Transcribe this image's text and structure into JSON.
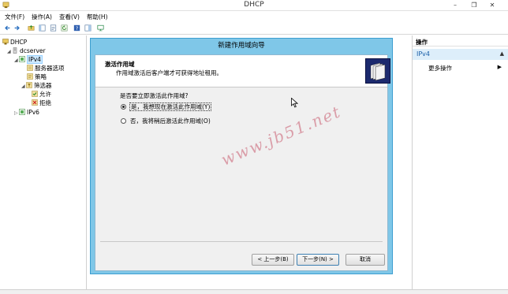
{
  "window": {
    "title": "DHCP",
    "controls": {
      "minimize": "–",
      "restore": "❐",
      "close": "✕"
    }
  },
  "menu": [
    {
      "label": "文件(F)"
    },
    {
      "label": "操作(A)"
    },
    {
      "label": "查看(V)"
    },
    {
      "label": "帮助(H)"
    }
  ],
  "toolbar": {
    "icons": [
      "back-arrow-icon",
      "forward-arrow-icon",
      "up-folder-icon",
      "show-tree-icon",
      "properties-icon",
      "refresh-icon",
      "help-icon",
      "panel-icon",
      "monitor-icon"
    ]
  },
  "tree": {
    "root": "DHCP",
    "server": "dcserver",
    "ipv4": "IPv4",
    "server_options": "服务器选项",
    "policies": "策略",
    "filters": "筛选器",
    "allow": "允许",
    "deny": "拒绝",
    "ipv6": "IPv6"
  },
  "actions": {
    "header": "操作",
    "section": "IPv4",
    "more": "更多操作"
  },
  "wizard": {
    "title": "新建作用域向导",
    "heading": "激活作用域",
    "subheading": "作用域激活后客户端才可获得地址租用。",
    "question": "是否要立即激活此作用域?",
    "option_yes": "是，我想现在激活此作用域(Y)",
    "option_no": "否，我将稍后激活此作用域(O)",
    "selected": "yes",
    "buttons": {
      "back": "< 上一步(B)",
      "next": "下一步(N) >",
      "cancel": "取消"
    }
  },
  "watermark": "www.jb51.net",
  "colors": {
    "wizard_frame": "#7fc7e8",
    "action_section_bg": "#ddeefa",
    "selection": "#cce8ff"
  }
}
